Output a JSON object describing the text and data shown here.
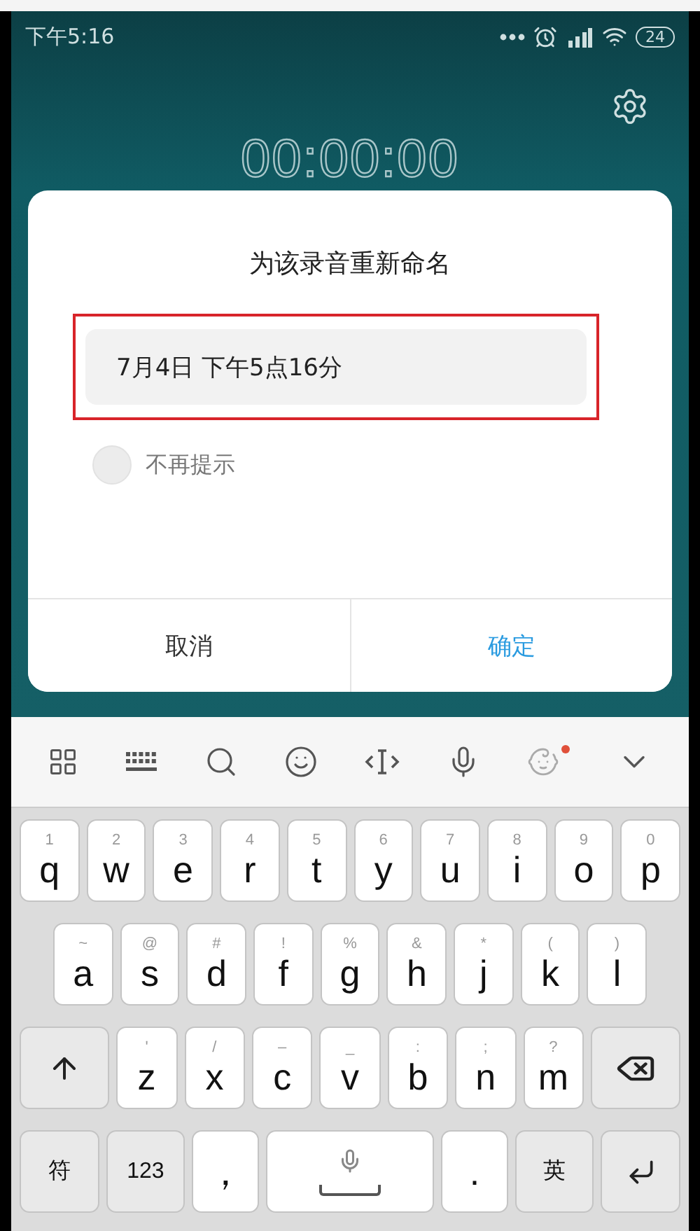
{
  "status_bar": {
    "time": "下午5:16",
    "battery": "24"
  },
  "recorder": {
    "timer": "00:00:00"
  },
  "dialog": {
    "title": "为该录音重新命名",
    "name_field": {
      "value": "7月4日 下午5点16分",
      "highlighted": true
    },
    "dont_remind": {
      "label": "不再提示",
      "checked": false
    },
    "buttons": [
      {
        "label": "取消",
        "kind": "cancel"
      },
      {
        "label": "确定",
        "kind": "confirm"
      }
    ]
  },
  "keyboard": {
    "skin_badge": true,
    "rows": [
      {
        "keys": [
          {
            "kind": "letter",
            "label": "q",
            "hint": "1"
          },
          {
            "kind": "letter",
            "label": "w",
            "hint": "2"
          },
          {
            "kind": "letter",
            "label": "e",
            "hint": "3"
          },
          {
            "kind": "letter",
            "label": "r",
            "hint": "4"
          },
          {
            "kind": "letter",
            "label": "t",
            "hint": "5"
          },
          {
            "kind": "letter",
            "label": "y",
            "hint": "6"
          },
          {
            "kind": "letter",
            "label": "u",
            "hint": "7"
          },
          {
            "kind": "letter",
            "label": "i",
            "hint": "8"
          },
          {
            "kind": "letter",
            "label": "o",
            "hint": "9"
          },
          {
            "kind": "letter",
            "label": "p",
            "hint": "0"
          }
        ]
      },
      {
        "keys": [
          {
            "kind": "letter",
            "label": "a",
            "hint": "~"
          },
          {
            "kind": "letter",
            "label": "s",
            "hint": "@"
          },
          {
            "kind": "letter",
            "label": "d",
            "hint": "#"
          },
          {
            "kind": "letter",
            "label": "f",
            "hint": "!"
          },
          {
            "kind": "letter",
            "label": "g",
            "hint": "%"
          },
          {
            "kind": "letter",
            "label": "h",
            "hint": "&"
          },
          {
            "kind": "letter",
            "label": "j",
            "hint": "*"
          },
          {
            "kind": "letter",
            "label": "k",
            "hint": "("
          },
          {
            "kind": "letter",
            "label": "l",
            "hint": ")"
          }
        ]
      },
      {
        "keys": [
          {
            "kind": "shift"
          },
          {
            "kind": "letter",
            "label": "z",
            "hint": "'"
          },
          {
            "kind": "letter",
            "label": "x",
            "hint": "/"
          },
          {
            "kind": "letter",
            "label": "c",
            "hint": "–"
          },
          {
            "kind": "letter",
            "label": "v",
            "hint": "_"
          },
          {
            "kind": "letter",
            "label": "b",
            "hint": ":"
          },
          {
            "kind": "letter",
            "label": "n",
            "hint": ";"
          },
          {
            "kind": "letter",
            "label": "m",
            "hint": "?"
          },
          {
            "kind": "backspace"
          }
        ]
      },
      {
        "keys": [
          {
            "kind": "func",
            "label": "符"
          },
          {
            "kind": "func",
            "label": "123"
          },
          {
            "kind": "char",
            "label": "，"
          },
          {
            "kind": "space"
          },
          {
            "kind": "char",
            "label": "."
          },
          {
            "kind": "func",
            "label": "英"
          },
          {
            "kind": "enter"
          }
        ]
      }
    ]
  }
}
